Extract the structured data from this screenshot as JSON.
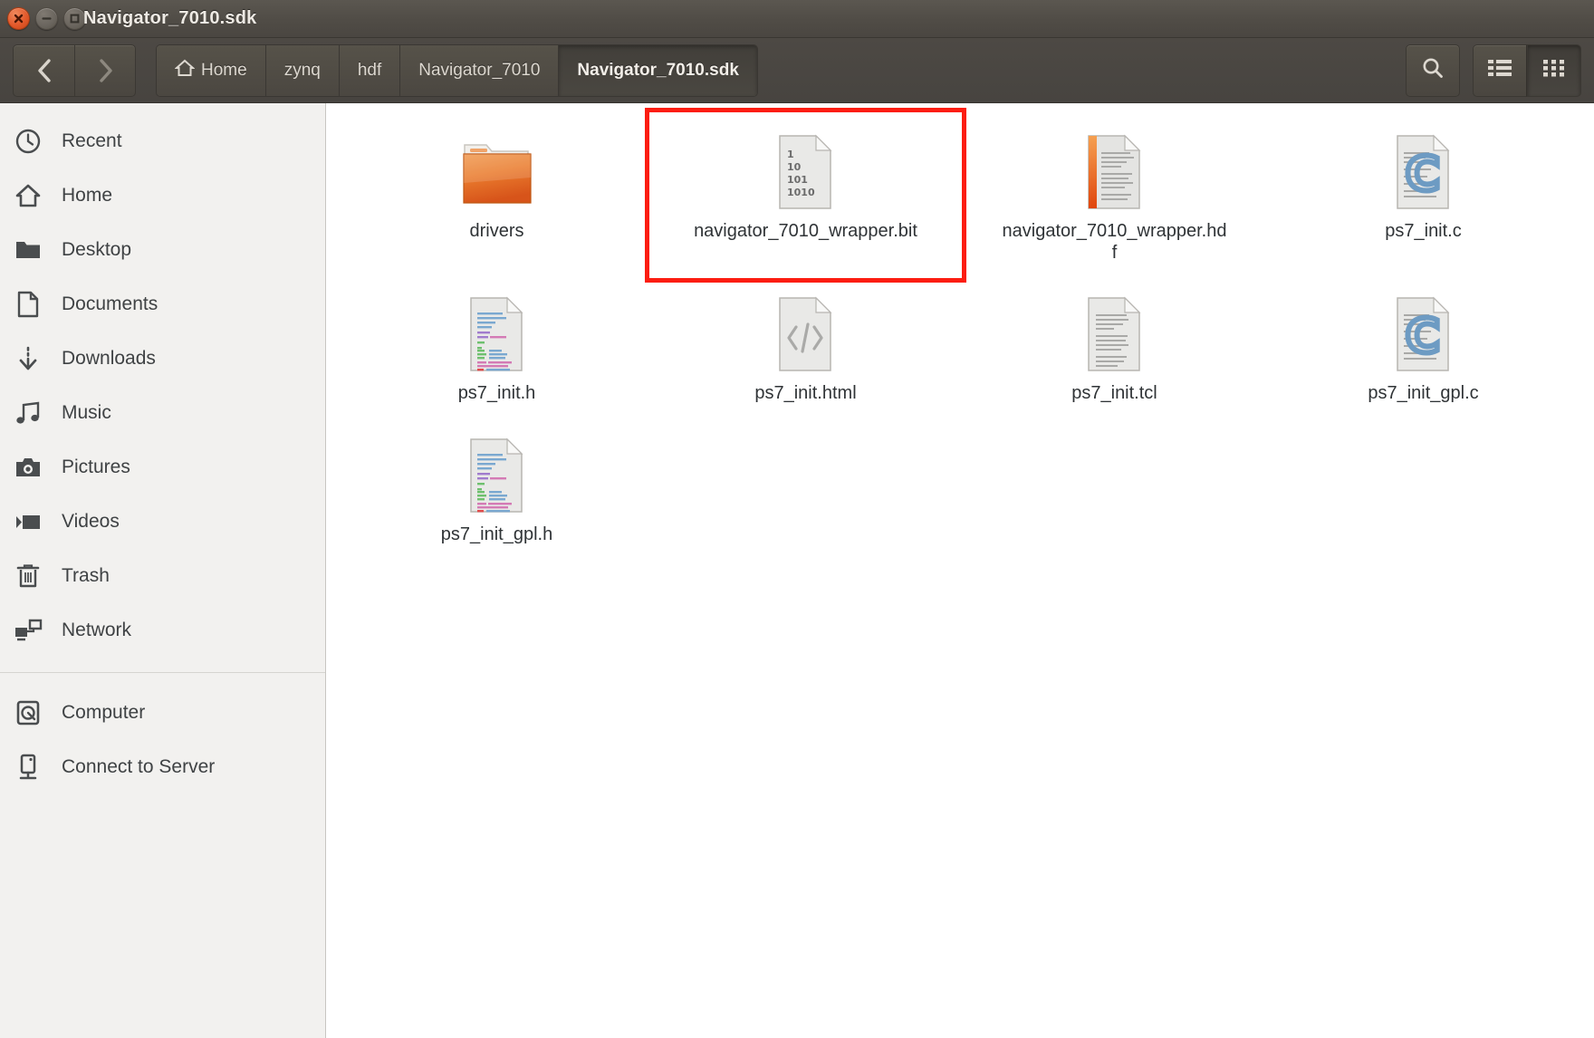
{
  "window": {
    "title": "Navigator_7010.sdk",
    "controls": [
      {
        "name": "close",
        "label": "Close"
      },
      {
        "name": "minimize",
        "label": "Minimize"
      },
      {
        "name": "maximize",
        "label": "Maximize"
      }
    ]
  },
  "toolbar": {
    "back_label": "Back",
    "forward_label": "Forward",
    "search_label": "Search",
    "list_view_label": "List view",
    "grid_view_label": "Icon view",
    "active_view": "grid",
    "breadcrumb": [
      {
        "label": "Home",
        "icon": "home-icon",
        "active": false
      },
      {
        "label": "zynq",
        "icon": "",
        "active": false
      },
      {
        "label": "hdf",
        "icon": "",
        "active": false
      },
      {
        "label": "Navigator_7010",
        "icon": "",
        "active": false
      },
      {
        "label": "Navigator_7010.sdk",
        "icon": "",
        "active": true
      }
    ]
  },
  "sidebar": {
    "items": [
      {
        "label": "Recent",
        "icon": "clock-icon"
      },
      {
        "label": "Home",
        "icon": "home-icon"
      },
      {
        "label": "Desktop",
        "icon": "folder-icon"
      },
      {
        "label": "Documents",
        "icon": "document-icon"
      },
      {
        "label": "Downloads",
        "icon": "download-icon"
      },
      {
        "label": "Music",
        "icon": "music-note-icon"
      },
      {
        "label": "Pictures",
        "icon": "camera-icon"
      },
      {
        "label": "Videos",
        "icon": "video-camera-icon"
      },
      {
        "label": "Trash",
        "icon": "trash-icon"
      },
      {
        "label": "Network",
        "icon": "network-icon"
      }
    ],
    "items_below": [
      {
        "label": "Computer",
        "icon": "hard-drive-icon"
      },
      {
        "label": "Connect to Server",
        "icon": "server-icon"
      }
    ]
  },
  "files": [
    {
      "label": "drivers",
      "type": "folder",
      "highlighted": false
    },
    {
      "label": "navigator_7010_wrapper.bit",
      "type": "binary",
      "highlighted": true
    },
    {
      "label": "navigator_7010_wrapper.hdf",
      "type": "hdf",
      "highlighted": false
    },
    {
      "label": "ps7_init.c",
      "type": "c-source",
      "highlighted": false
    },
    {
      "label": "ps7_init.h",
      "type": "header",
      "highlighted": false
    },
    {
      "label": "ps7_init.html",
      "type": "html",
      "highlighted": false
    },
    {
      "label": "ps7_init.tcl",
      "type": "text",
      "highlighted": false
    },
    {
      "label": "ps7_init_gpl.c",
      "type": "c-source",
      "highlighted": false
    },
    {
      "label": "ps7_init_gpl.h",
      "type": "header",
      "highlighted": false
    }
  ],
  "binary_icon_lines": [
    "1",
    "10",
    "101",
    "1010"
  ],
  "colors": {
    "chrome": "#4a4640",
    "titlebar_text": "#eeeae4",
    "close_button": "#e3592b",
    "folder_orange": "#e8762a",
    "highlight_red": "#fc1d11",
    "sidebar_bg": "#f2f1ef",
    "content_bg": "#ffffff",
    "c_letter_blue": "#6e9cc4"
  }
}
